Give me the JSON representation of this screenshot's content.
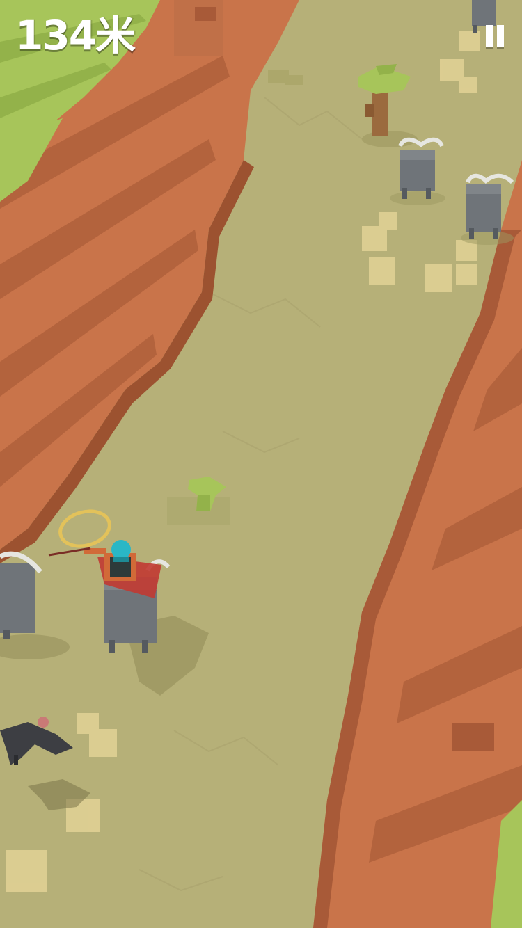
{
  "hud": {
    "distance_label": "134米",
    "pause_icon": "pause-icon"
  },
  "palette": {
    "ground": "#b8b27a",
    "cliff": "#c9744a",
    "cliff_dark": "#a85a38",
    "grass": "#a7c55a",
    "buffalo": "#6f7479",
    "dust": "#e8d79a"
  }
}
